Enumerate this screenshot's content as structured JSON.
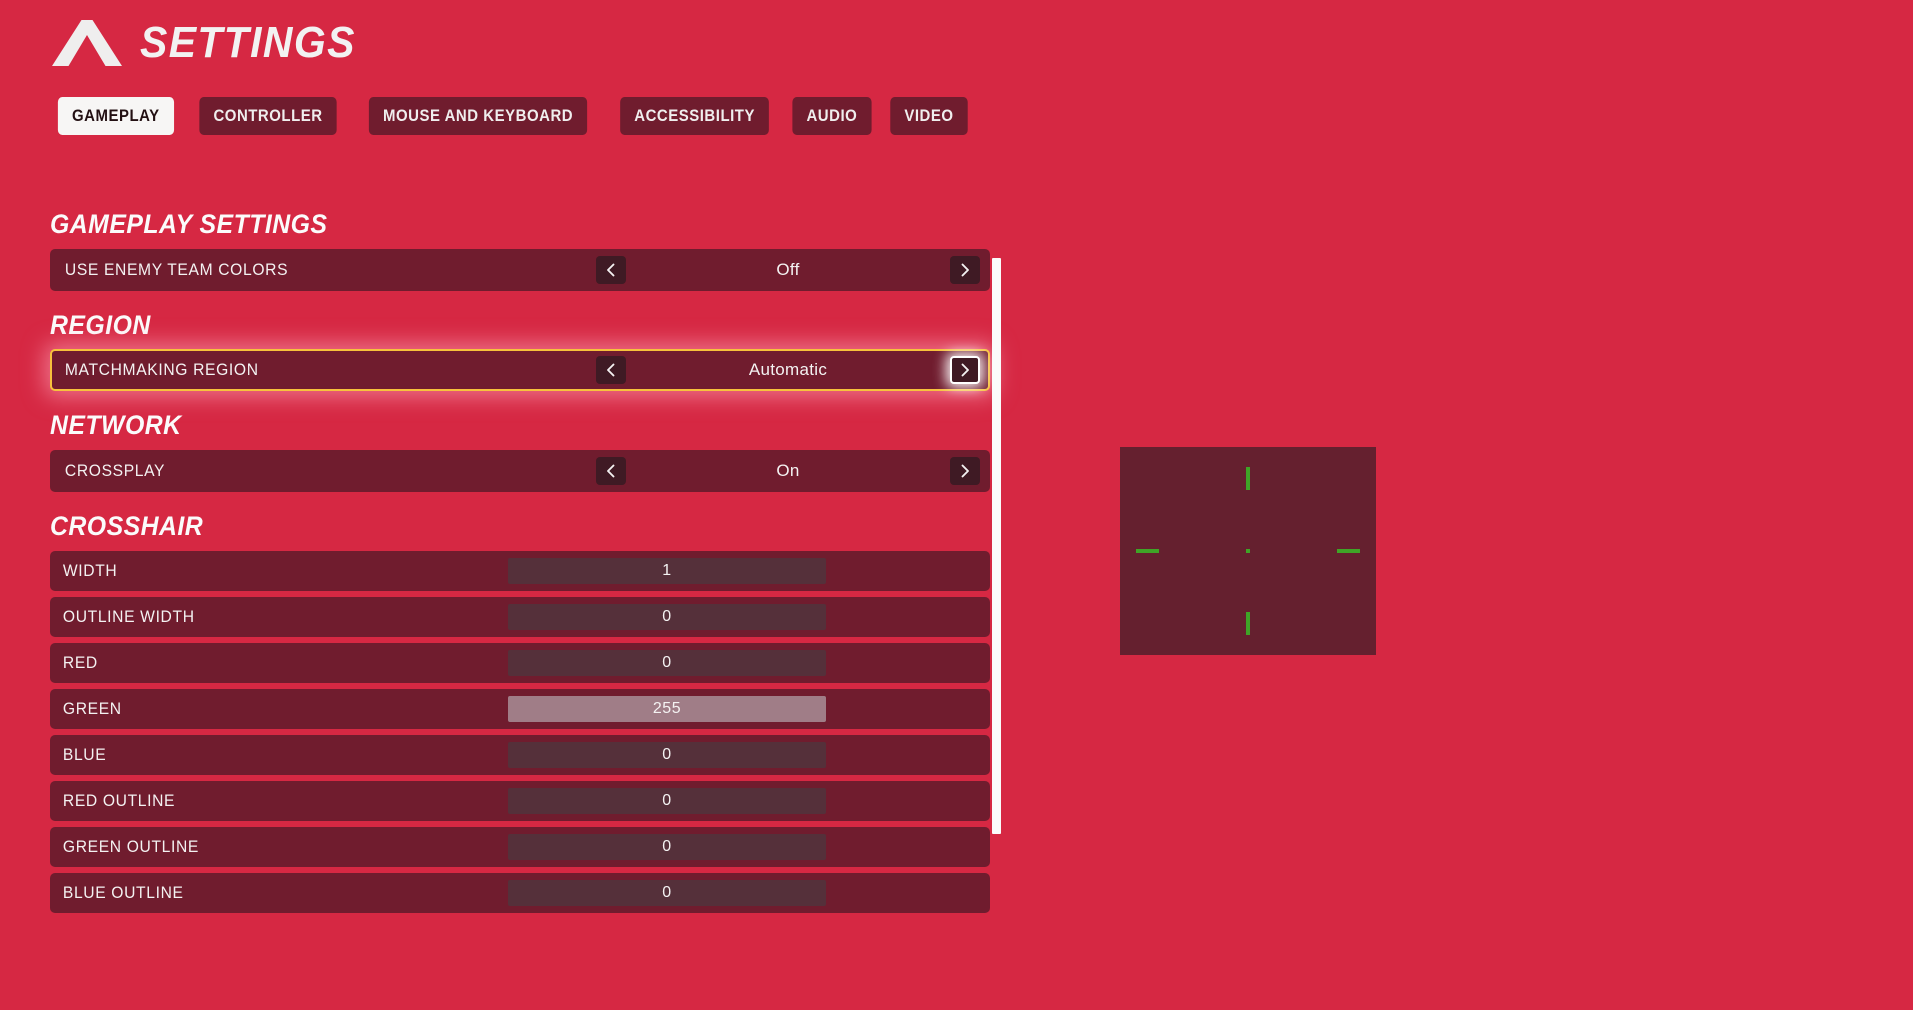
{
  "header": {
    "logo_icon": "mountain-a-logo",
    "title": "SETTINGS"
  },
  "tabs": [
    {
      "label": "GAMEPLAY",
      "active": true
    },
    {
      "label": "CONTROLLER",
      "active": false
    },
    {
      "label": "MOUSE AND KEYBOARD",
      "active": false
    },
    {
      "label": "ACCESSIBILITY",
      "active": false
    },
    {
      "label": "AUDIO",
      "active": false
    },
    {
      "label": "VIDEO",
      "active": false
    }
  ],
  "sections": [
    {
      "title": "GAMEPLAY SETTINGS",
      "rows": [
        {
          "type": "selector",
          "label": "USE ENEMY TEAM COLORS",
          "value": "Off",
          "focused": false,
          "left_icon": "chevron-left-icon",
          "right_icon": "chevron-right-icon"
        }
      ]
    },
    {
      "title": "REGION",
      "rows": [
        {
          "type": "selector",
          "label": "MATCHMAKING REGION",
          "value": "Automatic",
          "focused": true,
          "focused_control": "right",
          "left_icon": "chevron-left-icon",
          "right_icon": "chevron-right-icon"
        }
      ]
    },
    {
      "title": "NETWORK",
      "rows": [
        {
          "type": "selector",
          "label": "CROSSPLAY",
          "value": "On",
          "focused": false,
          "left_icon": "chevron-left-icon",
          "right_icon": "chevron-right-icon"
        }
      ]
    },
    {
      "title": "CROSSHAIR",
      "rows": [
        {
          "type": "slider",
          "label": "WIDTH",
          "value": "1",
          "fill_percent": 0
        },
        {
          "type": "slider",
          "label": "OUTLINE WIDTH",
          "value": "0",
          "fill_percent": 0
        },
        {
          "type": "slider",
          "label": "RED",
          "value": "0",
          "fill_percent": 0
        },
        {
          "type": "slider",
          "label": "GREEN",
          "value": "255",
          "fill_percent": 100
        },
        {
          "type": "slider",
          "label": "BLUE",
          "value": "0",
          "fill_percent": 0
        },
        {
          "type": "slider",
          "label": "RED OUTLINE",
          "value": "0",
          "fill_percent": 0
        },
        {
          "type": "slider",
          "label": "GREEN OUTLINE",
          "value": "0",
          "fill_percent": 0
        },
        {
          "type": "slider",
          "label": "BLUE OUTLINE",
          "value": "0",
          "fill_percent": 0
        }
      ]
    }
  ],
  "scrollbar": {
    "name": "settings-scrollbar",
    "thumb_position_percent": 0,
    "thumb_size_percent": 100
  },
  "crosshair_preview": {
    "name": "crosshair-preview",
    "crosshair_color": "#3fa427",
    "background_color": "#65202f",
    "marks": [
      "top",
      "bottom",
      "left",
      "right",
      "center-dot"
    ]
  },
  "colors": {
    "page_background": "#d62843",
    "row_background": "#701c2e",
    "arrow_button": "#3f1a24",
    "slider_track": "#55303a",
    "slider_fill": "#a07d87",
    "focus_border": "#f7c13c",
    "active_tab_background": "#f7f6f5",
    "active_tab_text": "#231013",
    "text": "#f4f2f2"
  }
}
